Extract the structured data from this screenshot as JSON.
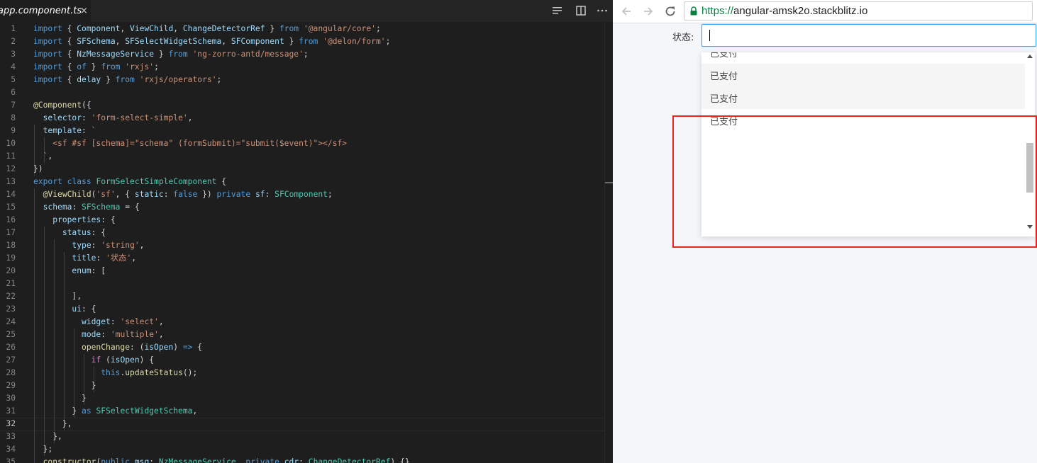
{
  "editor": {
    "tab": {
      "title": "app.component.ts",
      "close": "×"
    },
    "icons": {
      "split": "split-editor-icon",
      "layout": "toggle-layout-icon",
      "more": "more-actions-icon",
      "close": "close-icon"
    },
    "active_line": 32,
    "lines": [
      {
        "n": "1",
        "t": [
          [
            "kw",
            "import"
          ],
          [
            "p",
            " { "
          ],
          [
            "id",
            "Component"
          ],
          [
            "p",
            ", "
          ],
          [
            "id",
            "ViewChild"
          ],
          [
            "p",
            ", "
          ],
          [
            "id",
            "ChangeDetectorRef"
          ],
          [
            "p",
            " } "
          ],
          [
            "kw",
            "from"
          ],
          [
            "p",
            " "
          ],
          [
            "str",
            "'@angular/core'"
          ],
          [
            "p",
            ";"
          ]
        ]
      },
      {
        "n": "2",
        "t": [
          [
            "kw",
            "import"
          ],
          [
            "p",
            " { "
          ],
          [
            "id",
            "SFSchema"
          ],
          [
            "p",
            ", "
          ],
          [
            "id",
            "SFSelectWidgetSchema"
          ],
          [
            "p",
            ", "
          ],
          [
            "id",
            "SFComponent"
          ],
          [
            "p",
            " } "
          ],
          [
            "kw",
            "from"
          ],
          [
            "p",
            " "
          ],
          [
            "str",
            "'@delon/form'"
          ],
          [
            "p",
            ";"
          ]
        ]
      },
      {
        "n": "3",
        "t": [
          [
            "kw",
            "import"
          ],
          [
            "p",
            " { "
          ],
          [
            "id",
            "NzMessageService"
          ],
          [
            "p",
            " } "
          ],
          [
            "kw",
            "from"
          ],
          [
            "p",
            " "
          ],
          [
            "str",
            "'ng-zorro-antd/message'"
          ],
          [
            "p",
            ";"
          ]
        ]
      },
      {
        "n": "4",
        "t": [
          [
            "kw",
            "import"
          ],
          [
            "p",
            " { "
          ],
          [
            "kw",
            "of"
          ],
          [
            "p",
            " } "
          ],
          [
            "kw",
            "from"
          ],
          [
            "p",
            " "
          ],
          [
            "str",
            "'rxjs'"
          ],
          [
            "p",
            ";"
          ]
        ]
      },
      {
        "n": "5",
        "t": [
          [
            "kw",
            "import"
          ],
          [
            "p",
            " { "
          ],
          [
            "id",
            "delay"
          ],
          [
            "p",
            " } "
          ],
          [
            "kw",
            "from"
          ],
          [
            "p",
            " "
          ],
          [
            "str",
            "'rxjs/operators'"
          ],
          [
            "p",
            ";"
          ]
        ]
      },
      {
        "n": "6",
        "t": []
      },
      {
        "n": "7",
        "t": [
          [
            "dec",
            "@Component"
          ],
          [
            "p",
            "({"
          ]
        ]
      },
      {
        "n": "8",
        "t": [
          [
            "p",
            "  "
          ],
          [
            "id",
            "selector"
          ],
          [
            "p",
            ": "
          ],
          [
            "str",
            "'form-select-simple'"
          ],
          [
            "p",
            ","
          ]
        ]
      },
      {
        "n": "9",
        "t": [
          [
            "p",
            "  "
          ],
          [
            "id",
            "template"
          ],
          [
            "p",
            ": "
          ],
          [
            "str",
            "`"
          ]
        ]
      },
      {
        "n": "10",
        "t": [
          [
            "p",
            "    "
          ],
          [
            "str",
            "<sf #sf [schema]=\"schema\" (formSubmit)=\"submit($event)\"></sf>"
          ]
        ]
      },
      {
        "n": "11",
        "t": [
          [
            "p",
            "  "
          ],
          [
            "str",
            "`"
          ],
          [
            "p",
            ","
          ]
        ]
      },
      {
        "n": "12",
        "t": [
          [
            "p",
            "})"
          ]
        ]
      },
      {
        "n": "13",
        "t": [
          [
            "kw",
            "export"
          ],
          [
            "p",
            " "
          ],
          [
            "kw",
            "class"
          ],
          [
            "p",
            " "
          ],
          [
            "ty",
            "FormSelectSimpleComponent"
          ],
          [
            "p",
            " {"
          ]
        ]
      },
      {
        "n": "14",
        "t": [
          [
            "p",
            "  "
          ],
          [
            "dec",
            "@ViewChild"
          ],
          [
            "p",
            "("
          ],
          [
            "str",
            "'sf'"
          ],
          [
            "p",
            ", { "
          ],
          [
            "id",
            "static"
          ],
          [
            "p",
            ": "
          ],
          [
            "kw",
            "false"
          ],
          [
            "p",
            " }) "
          ],
          [
            "kw",
            "private"
          ],
          [
            "p",
            " "
          ],
          [
            "id",
            "sf"
          ],
          [
            "p",
            ": "
          ],
          [
            "ty",
            "SFComponent"
          ],
          [
            "p",
            ";"
          ]
        ]
      },
      {
        "n": "15",
        "t": [
          [
            "p",
            "  "
          ],
          [
            "id",
            "schema"
          ],
          [
            "p",
            ": "
          ],
          [
            "ty",
            "SFSchema"
          ],
          [
            "p",
            " = {"
          ]
        ]
      },
      {
        "n": "16",
        "t": [
          [
            "p",
            "    "
          ],
          [
            "id",
            "properties"
          ],
          [
            "p",
            ": {"
          ]
        ]
      },
      {
        "n": "17",
        "t": [
          [
            "p",
            "      "
          ],
          [
            "id",
            "status"
          ],
          [
            "p",
            ": {"
          ]
        ]
      },
      {
        "n": "18",
        "t": [
          [
            "p",
            "        "
          ],
          [
            "id",
            "type"
          ],
          [
            "p",
            ": "
          ],
          [
            "str",
            "'string'"
          ],
          [
            "p",
            ","
          ]
        ]
      },
      {
        "n": "19",
        "t": [
          [
            "p",
            "        "
          ],
          [
            "id",
            "title"
          ],
          [
            "p",
            ": "
          ],
          [
            "str",
            "'状态'"
          ],
          [
            "p",
            ","
          ]
        ]
      },
      {
        "n": "20",
        "t": [
          [
            "p",
            "        "
          ],
          [
            "id",
            "enum"
          ],
          [
            "p",
            ": ["
          ]
        ]
      },
      {
        "n": "21",
        "t": []
      },
      {
        "n": "22",
        "t": [
          [
            "p",
            "        ],"
          ]
        ]
      },
      {
        "n": "23",
        "t": [
          [
            "p",
            "        "
          ],
          [
            "id",
            "ui"
          ],
          [
            "p",
            ": {"
          ]
        ]
      },
      {
        "n": "24",
        "t": [
          [
            "p",
            "          "
          ],
          [
            "id",
            "widget"
          ],
          [
            "p",
            ": "
          ],
          [
            "str",
            "'select'"
          ],
          [
            "p",
            ","
          ]
        ]
      },
      {
        "n": "25",
        "t": [
          [
            "p",
            "          "
          ],
          [
            "id",
            "mode"
          ],
          [
            "p",
            ": "
          ],
          [
            "str",
            "'multiple'"
          ],
          [
            "p",
            ","
          ]
        ]
      },
      {
        "n": "26",
        "t": [
          [
            "p",
            "          "
          ],
          [
            "fn",
            "openChange"
          ],
          [
            "p",
            ": ("
          ],
          [
            "id",
            "isOpen"
          ],
          [
            "p",
            ") "
          ],
          [
            "kw",
            "=>"
          ],
          [
            "p",
            " {"
          ]
        ]
      },
      {
        "n": "27",
        "t": [
          [
            "p",
            "            "
          ],
          [
            "ctl",
            "if"
          ],
          [
            "p",
            " ("
          ],
          [
            "id",
            "isOpen"
          ],
          [
            "p",
            ") {"
          ]
        ]
      },
      {
        "n": "28",
        "t": [
          [
            "p",
            "              "
          ],
          [
            "kw",
            "this"
          ],
          [
            "p",
            "."
          ],
          [
            "fn",
            "updateStatus"
          ],
          [
            "p",
            "();"
          ]
        ]
      },
      {
        "n": "29",
        "t": [
          [
            "p",
            "            }"
          ]
        ]
      },
      {
        "n": "30",
        "t": [
          [
            "p",
            "          }"
          ]
        ]
      },
      {
        "n": "31",
        "t": [
          [
            "p",
            "        } "
          ],
          [
            "kw",
            "as"
          ],
          [
            "p",
            " "
          ],
          [
            "ty",
            "SFSelectWidgetSchema"
          ],
          [
            "p",
            ","
          ]
        ]
      },
      {
        "n": "32",
        "t": [
          [
            "p",
            "      },"
          ]
        ]
      },
      {
        "n": "33",
        "t": [
          [
            "p",
            "    },"
          ]
        ]
      },
      {
        "n": "34",
        "t": [
          [
            "p",
            "  };"
          ]
        ]
      },
      {
        "n": "35",
        "t": [
          [
            "p",
            "  "
          ],
          [
            "fn",
            "constructor"
          ],
          [
            "p",
            "("
          ],
          [
            "kw",
            "public"
          ],
          [
            "p",
            " "
          ],
          [
            "id",
            "msg"
          ],
          [
            "p",
            ": "
          ],
          [
            "ty",
            "NzMessageService"
          ],
          [
            "p",
            ", "
          ],
          [
            "kw",
            "private"
          ],
          [
            "p",
            " "
          ],
          [
            "id",
            "cdr"
          ],
          [
            "p",
            ": "
          ],
          [
            "ty",
            "ChangeDetectorRef"
          ],
          [
            "p",
            ") {}"
          ]
        ]
      }
    ]
  },
  "browser": {
    "url_scheme": "https://",
    "url_host": "angular-amsk2o.stackblitz.io",
    "icons": {
      "back": "back-arrow-icon",
      "forward": "forward-arrow-icon",
      "reload": "reload-icon",
      "lock": "lock-icon"
    },
    "form": {
      "label": "状态:",
      "input_value": "",
      "options": [
        "已支付",
        "已支付",
        "已支付",
        "已支付"
      ]
    }
  },
  "annotation": {
    "color": "#e8241f"
  }
}
